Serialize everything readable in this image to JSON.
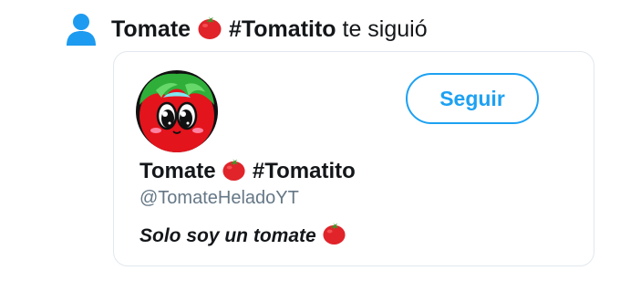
{
  "notification": {
    "icon": "person-icon",
    "user_name": "Tomate",
    "tomato_emoji": "🍅",
    "hashtag": "#Tomatito",
    "action": "te siguió"
  },
  "card": {
    "avatar_icon": "tomato-face-avatar",
    "follow_label": "Seguir",
    "display_name": "Tomate",
    "display_hashtag": "#Tomatito",
    "handle": "@TomateHeladoYT",
    "bio": "Solo soy un tomate"
  },
  "colors": {
    "accent": "#1da1f2",
    "icon_blue": "#1d9bf0",
    "text": "#14171a",
    "secondary_text": "#657786",
    "border": "#e1e8ed",
    "tomato_red": "#e0242a"
  }
}
